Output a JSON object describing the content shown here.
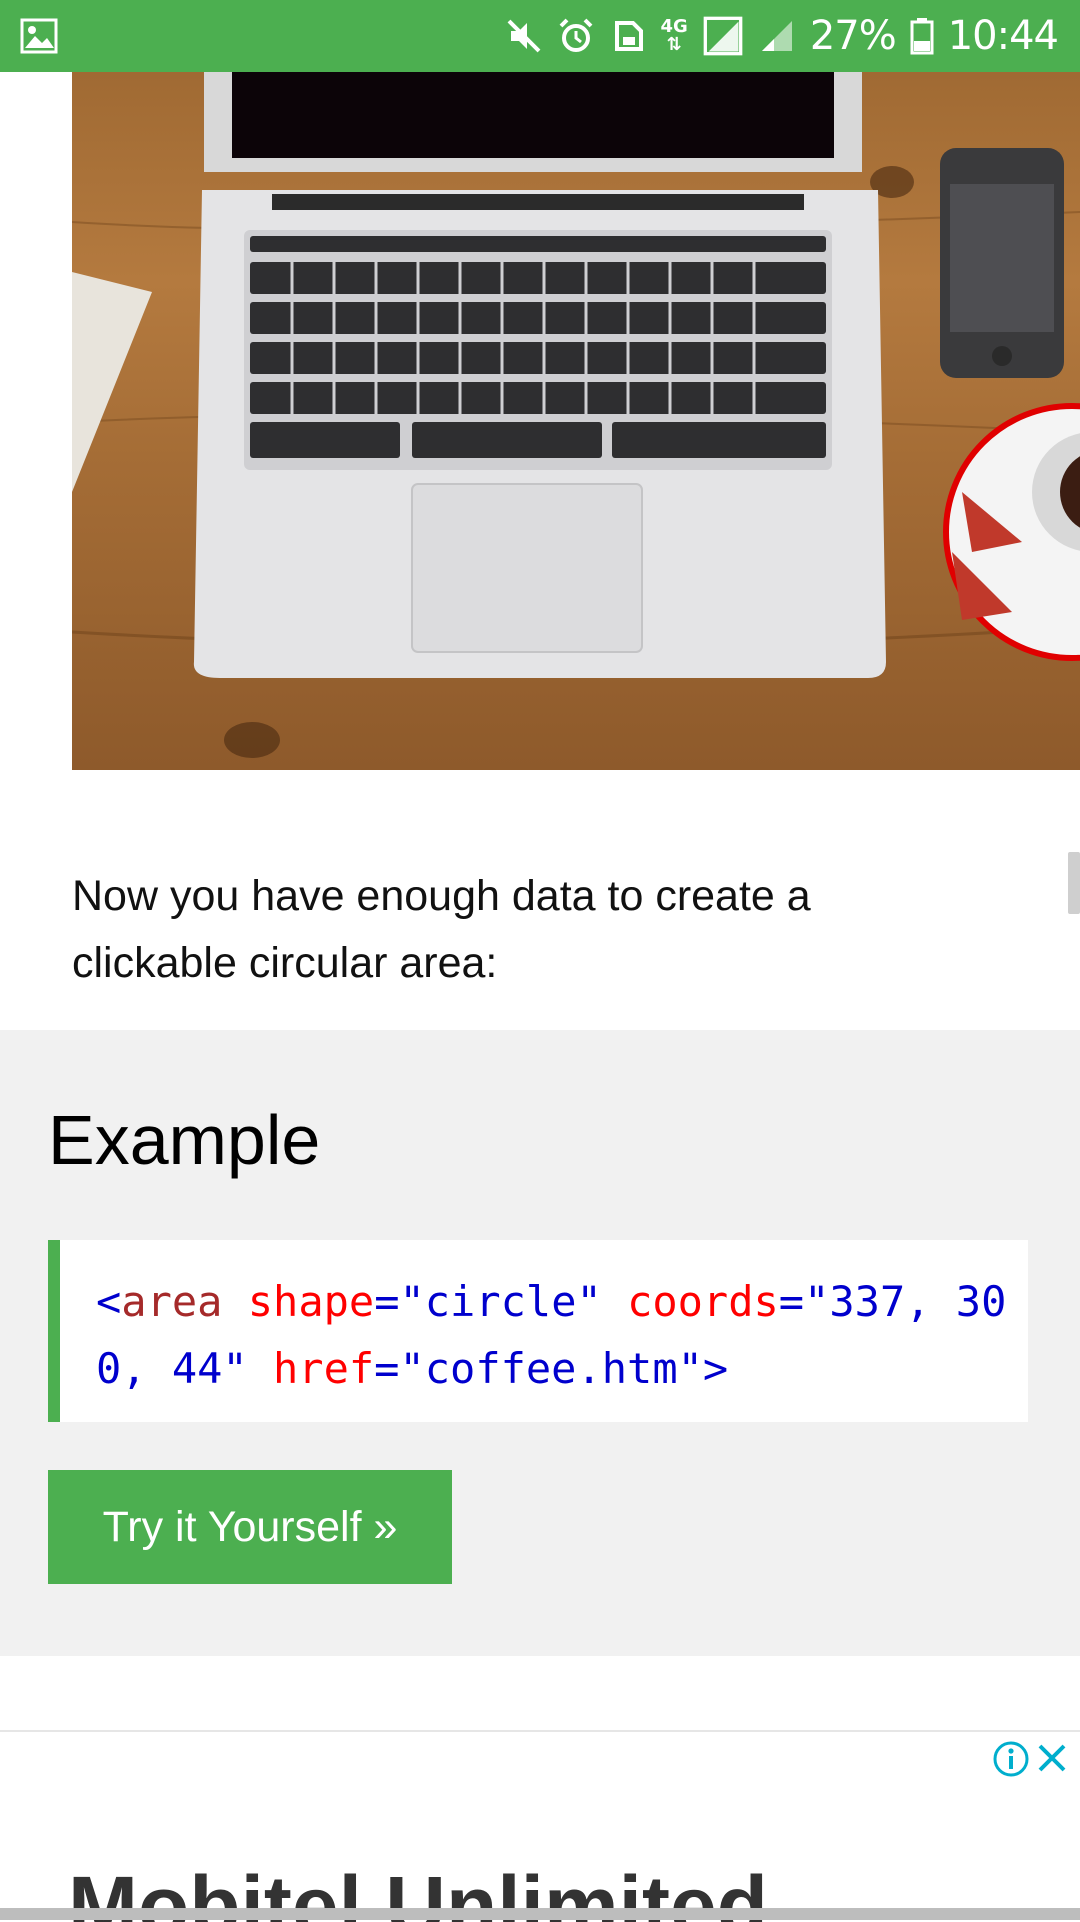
{
  "status_bar": {
    "battery_percent": "27%",
    "time": "10:44",
    "network_type": "4G",
    "icons": [
      "gallery-icon",
      "mute-icon",
      "alarm-icon",
      "sync-icon",
      "network-4g-icon",
      "signal-icon",
      "signal-weak-icon",
      "battery-icon"
    ]
  },
  "content": {
    "image_icon": "laptop-coffee-photo",
    "intro_text": "Now you have enough data to create a clickable circular area:"
  },
  "example": {
    "title": "Example",
    "code": {
      "open": "<",
      "tag": "area",
      "attr1": "shape",
      "eq1": "=",
      "val1": "\"circle\"",
      "attr2": "coords",
      "eq2": "=",
      "val2": "\"337, 300, 44\"",
      "attr3": "href",
      "eq3": "=",
      "val3": "\"coffee.htm\"",
      "close": ">"
    },
    "button_label": "Try it Yourself »"
  },
  "ad": {
    "headline": "Mobitel Unlimited"
  },
  "colors": {
    "accent": "#4caf50",
    "code_tag": "#a52a2a",
    "code_attr": "#ff0000",
    "code_value": "#0000cd"
  }
}
